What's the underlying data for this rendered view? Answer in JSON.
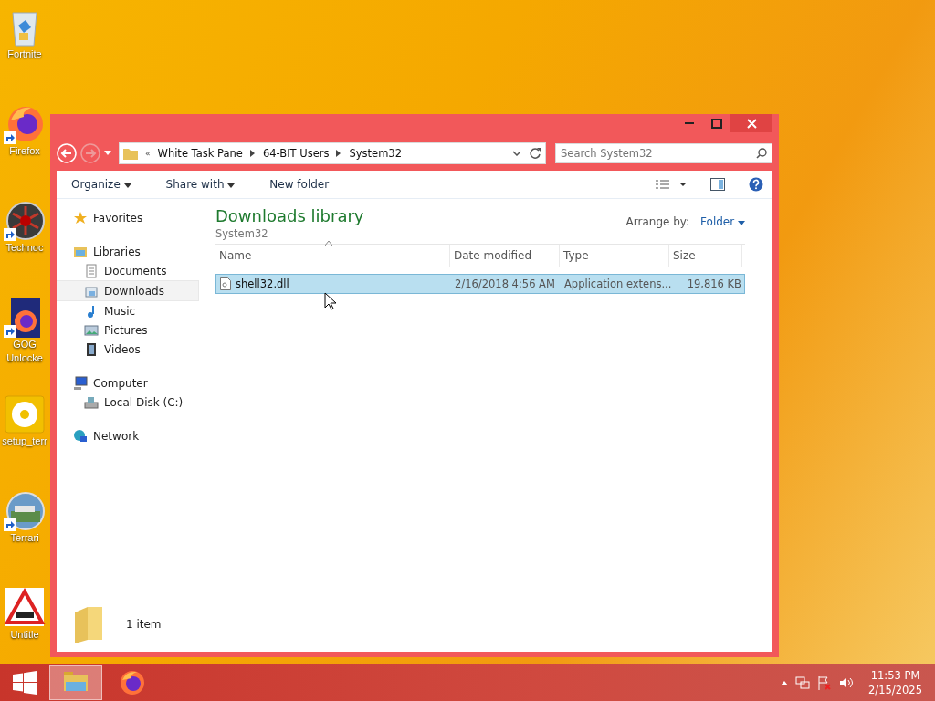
{
  "desktop": {
    "icons": [
      {
        "label": "Fortnite",
        "kind": "bin",
        "shortcut": false
      },
      {
        "label": "Firefox",
        "kind": "firefox",
        "shortcut": true
      },
      {
        "label": "Technoc",
        "kind": "disc",
        "shortcut": true
      },
      {
        "label": "GOG Unlocke",
        "kind": "doc",
        "shortcut": true
      },
      {
        "label": "setup_terr",
        "kind": "cd",
        "shortcut": false
      },
      {
        "label": "Terrari",
        "kind": "globe",
        "shortcut": true
      },
      {
        "label": "Untitle",
        "kind": "sign",
        "shortcut": false
      }
    ]
  },
  "window": {
    "nav": {
      "back_disabled": false,
      "forward_disabled": true
    },
    "breadcrumb_overflow": "«",
    "breadcrumb": [
      "White Task Pane",
      "64-BIT Users",
      "System32"
    ],
    "search": {
      "placeholder": "Search System32"
    },
    "toolbar": [
      {
        "label": "Organize",
        "dropdown": true
      },
      {
        "label": "Share with",
        "dropdown": true
      },
      {
        "label": "New folder",
        "dropdown": false
      }
    ],
    "nav_pane": [
      {
        "label": "Favorites",
        "kind": "star",
        "selected": false
      },
      {
        "label": "Libraries",
        "kind": "library",
        "selected": false,
        "children": [
          {
            "label": "Documents",
            "kind": "document",
            "selected": false
          },
          {
            "label": "Downloads",
            "kind": "download",
            "selected": true
          },
          {
            "label": "Music",
            "kind": "music",
            "selected": false
          },
          {
            "label": "Pictures",
            "kind": "picture",
            "selected": false
          },
          {
            "label": "Videos",
            "kind": "video",
            "selected": false
          }
        ]
      },
      {
        "label": "Computer",
        "kind": "computer",
        "selected": false,
        "children": [
          {
            "label": "Local Disk (C:)",
            "kind": "disk",
            "selected": false
          }
        ]
      },
      {
        "label": "Network",
        "kind": "network",
        "selected": false
      }
    ],
    "library": {
      "title": "Downloads library",
      "subtitle": "System32",
      "arrange_label": "Arrange by:",
      "arrange_value": "Folder"
    },
    "columns": [
      {
        "label": "Name",
        "sorted": true
      },
      {
        "label": "Date modified",
        "sorted": false
      },
      {
        "label": "Type",
        "sorted": false
      },
      {
        "label": "Size",
        "sorted": false
      }
    ],
    "rows": [
      {
        "name": "shell32.dll",
        "date": "2/16/2018 4:56 AM",
        "type": "Application extens...",
        "size": "19,816 KB",
        "selected": true
      }
    ],
    "status": "1 item"
  },
  "taskbar": {
    "items": [
      {
        "kind": "explorer",
        "active": true
      },
      {
        "kind": "firefox",
        "active": false
      }
    ],
    "time": "11:53 PM",
    "date": "2/15/2025"
  }
}
